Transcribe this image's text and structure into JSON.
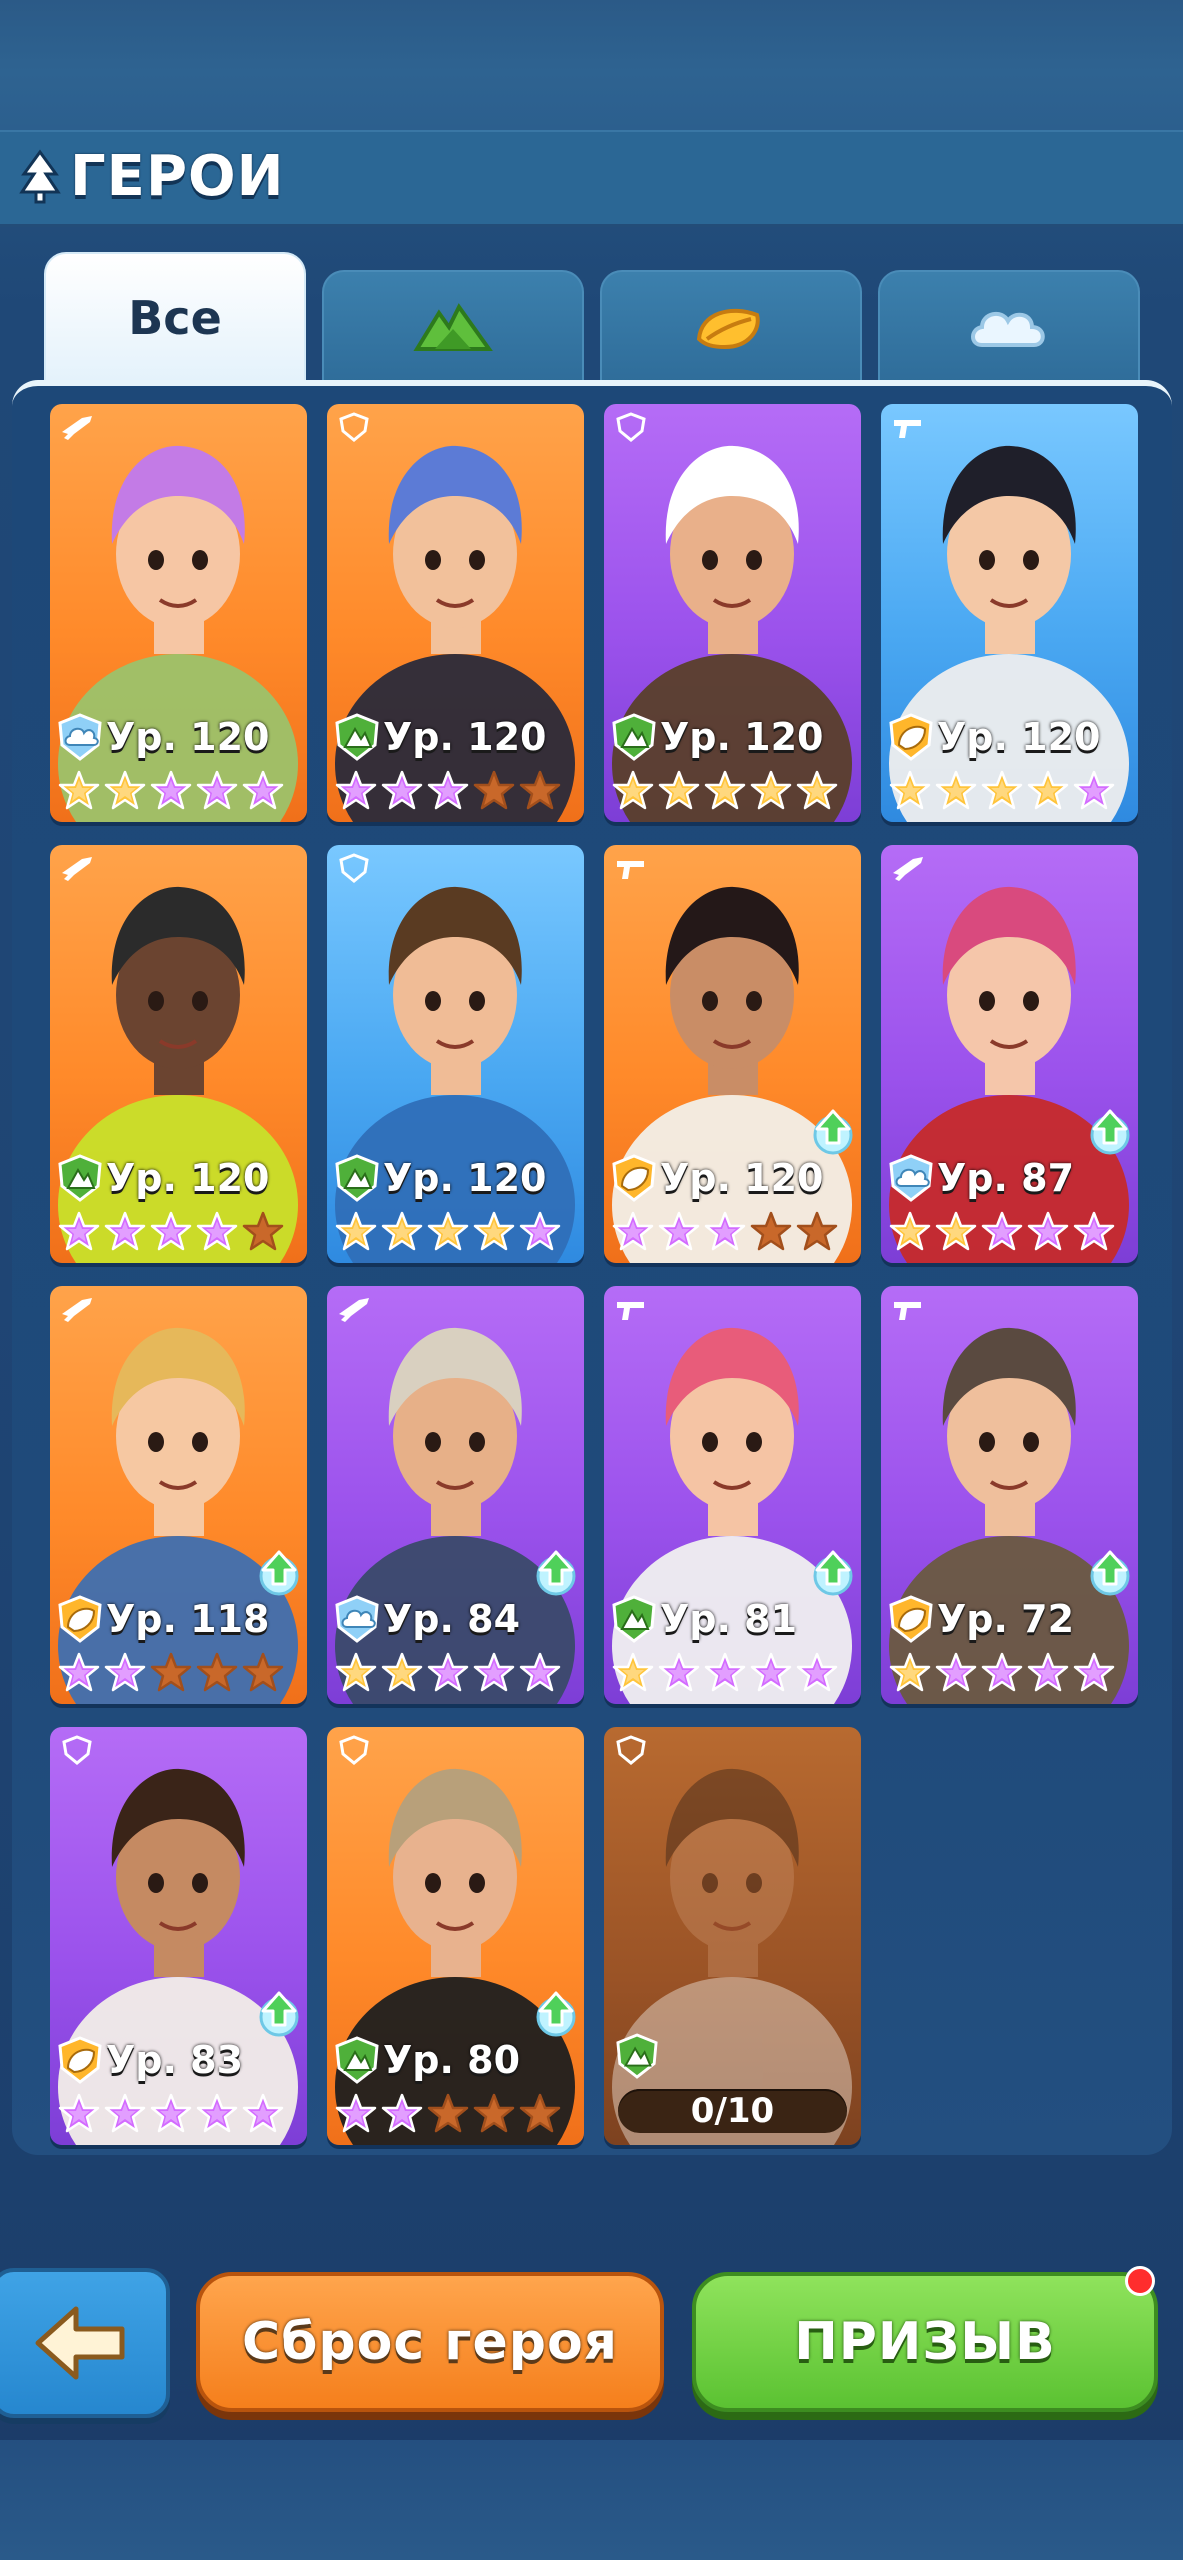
{
  "header": {
    "title": "ГЕРОИ",
    "icon": "tree-icon"
  },
  "tabs": [
    {
      "label": "Все",
      "active": true
    },
    {
      "label": "",
      "icon": "mountain-icon",
      "active": false
    },
    {
      "label": "",
      "icon": "leaf-icon",
      "active": false
    },
    {
      "label": "",
      "icon": "cloud-icon",
      "active": false
    }
  ],
  "heroes": [
    {
      "level": "Ур. 120",
      "bg": "orange",
      "element": "cloud",
      "role": "gun",
      "stars": [
        "gold",
        "gold",
        "purple",
        "purple",
        "purple"
      ],
      "upgrade": false
    },
    {
      "level": "Ур. 120",
      "bg": "orange",
      "element": "mountain",
      "role": "shield",
      "stars": [
        "purple",
        "purple",
        "purple",
        "empty",
        "empty"
      ],
      "upgrade": false
    },
    {
      "level": "Ур. 120",
      "bg": "purple",
      "element": "mountain",
      "role": "shield",
      "stars": [
        "gold",
        "gold",
        "gold",
        "gold",
        "gold"
      ],
      "upgrade": false
    },
    {
      "level": "Ур. 120",
      "bg": "blue",
      "element": "leaf",
      "role": "pistol",
      "stars": [
        "gold",
        "gold",
        "gold",
        "gold",
        "purple"
      ],
      "upgrade": false
    },
    {
      "level": "Ур. 120",
      "bg": "orange",
      "element": "mountain",
      "role": "gun",
      "stars": [
        "purple",
        "purple",
        "purple",
        "purple",
        "empty"
      ],
      "upgrade": false
    },
    {
      "level": "Ур. 120",
      "bg": "blue",
      "element": "mountain",
      "role": "shield",
      "stars": [
        "gold",
        "gold",
        "gold",
        "gold",
        "purple"
      ],
      "upgrade": false
    },
    {
      "level": "Ур. 120",
      "bg": "orange",
      "element": "leaf",
      "role": "pistol",
      "stars": [
        "purple",
        "purple",
        "purple",
        "empty",
        "empty"
      ],
      "upgrade": true
    },
    {
      "level": "Ур. 87",
      "bg": "purple",
      "element": "cloud",
      "role": "gun",
      "stars": [
        "gold",
        "gold",
        "purple",
        "purple",
        "purple"
      ],
      "upgrade": true
    },
    {
      "level": "Ур. 118",
      "bg": "orange",
      "element": "leaf",
      "role": "gun",
      "stars": [
        "purple",
        "purple",
        "empty",
        "empty",
        "empty"
      ],
      "upgrade": true
    },
    {
      "level": "Ур. 84",
      "bg": "purple",
      "element": "cloud",
      "role": "gun",
      "stars": [
        "gold",
        "gold",
        "purple",
        "purple",
        "purple"
      ],
      "upgrade": true
    },
    {
      "level": "Ур. 81",
      "bg": "purple",
      "element": "mountain",
      "role": "pistol",
      "stars": [
        "gold",
        "purple",
        "purple",
        "purple",
        "purple"
      ],
      "upgrade": true
    },
    {
      "level": "Ур. 72",
      "bg": "purple",
      "element": "leaf",
      "role": "pistol",
      "stars": [
        "gold",
        "purple",
        "purple",
        "purple",
        "purple"
      ],
      "upgrade": true
    },
    {
      "level": "Ур. 83",
      "bg": "purple",
      "element": "leaf",
      "role": "shield",
      "stars": [
        "purple",
        "purple",
        "purple",
        "purple",
        "purple"
      ],
      "upgrade": true
    },
    {
      "level": "Ур. 80",
      "bg": "orange",
      "element": "mountain",
      "role": "shield",
      "stars": [
        "purple",
        "purple",
        "empty",
        "empty",
        "empty"
      ],
      "upgrade": true
    }
  ],
  "locked_hero": {
    "shards": "0/10",
    "element": "mountain",
    "role": "shield"
  },
  "buttons": {
    "back": "",
    "reset": "Сброс героя",
    "summon": "ПРИЗЫВ"
  },
  "colors": {
    "star_gold": "#ffc43a",
    "star_purple": "#d36bff",
    "star_empty": "#c9682a"
  }
}
